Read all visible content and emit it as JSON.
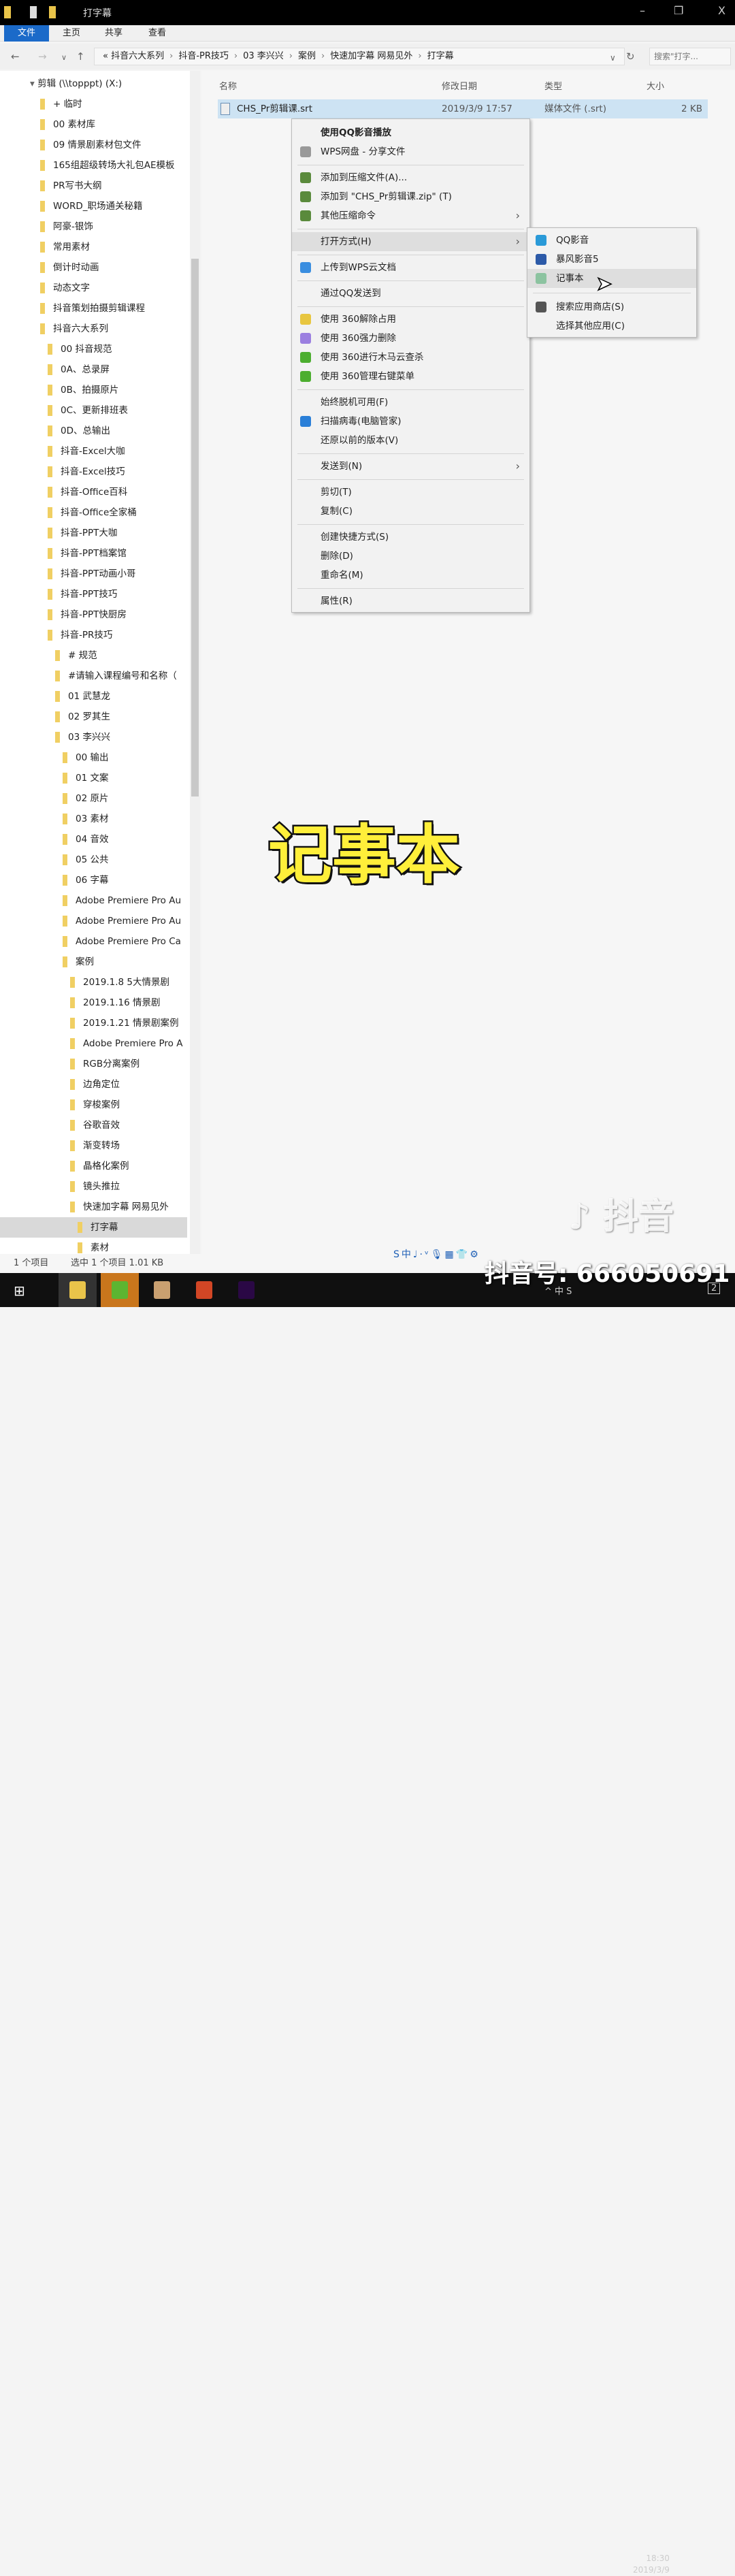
{
  "window": {
    "title": "打字幕",
    "min": "–",
    "max": "❐",
    "close": "X"
  },
  "ribbon": {
    "tabs": [
      "文件",
      "主页",
      "共享",
      "查看"
    ],
    "help": "?"
  },
  "address": {
    "crumbs": [
      "«",
      "抖音六大系列",
      "抖音-PR技巧",
      "03 李兴兴",
      "案例",
      "快速加字幕 网易见外",
      "打字幕"
    ],
    "search_placeholder": "搜索\"打字...",
    "search_icon": "magnifier-icon"
  },
  "columns": {
    "name": "名称",
    "date": "修改日期",
    "type": "类型",
    "size": "大小"
  },
  "file": {
    "name": "CHS_Pr剪辑课.srt",
    "date": "2019/3/9 17:57",
    "type": "媒体文件 (.srt)",
    "size": "2 KB"
  },
  "sidebar": [
    {
      "label": "剪辑 (\\\\topppt) (X:)",
      "level": -1,
      "drive": true
    },
    {
      "label": "+ 临时",
      "level": 0
    },
    {
      "label": "00 素材库",
      "level": 0
    },
    {
      "label": "09 情景剧素材包文件",
      "level": 0
    },
    {
      "label": "165组超级转场大礼包AE模板",
      "level": 0
    },
    {
      "label": "PR写书大纲",
      "level": 0
    },
    {
      "label": "WORD_职场通关秘籍",
      "level": 0
    },
    {
      "label": "阿豪-银饰",
      "level": 0
    },
    {
      "label": "常用素材",
      "level": 0
    },
    {
      "label": "倒计时动画",
      "level": 0
    },
    {
      "label": "动态文字",
      "level": 0
    },
    {
      "label": "抖音策划拍摄剪辑课程",
      "level": 0
    },
    {
      "label": "抖音六大系列",
      "level": 0
    },
    {
      "label": "00 抖音规范",
      "level": 1
    },
    {
      "label": "0A、总录屏",
      "level": 1
    },
    {
      "label": "0B、拍摄原片",
      "level": 1
    },
    {
      "label": "0C、更新排班表",
      "level": 1
    },
    {
      "label": "0D、总输出",
      "level": 1
    },
    {
      "label": "抖音-Excel大咖",
      "level": 1
    },
    {
      "label": "抖音-Excel技巧",
      "level": 1
    },
    {
      "label": "抖音-Office百科",
      "level": 1
    },
    {
      "label": "抖音-Office全家桶",
      "level": 1
    },
    {
      "label": "抖音-PPT大咖",
      "level": 1
    },
    {
      "label": "抖音-PPT档案馆",
      "level": 1
    },
    {
      "label": "抖音-PPT动画小哥",
      "level": 1
    },
    {
      "label": "抖音-PPT技巧",
      "level": 1
    },
    {
      "label": "抖音-PPT快厨房",
      "level": 1
    },
    {
      "label": "抖音-PR技巧",
      "level": 1
    },
    {
      "label": "# 规范",
      "level": 2
    },
    {
      "label": "#请输入课程编号和名称（",
      "level": 2
    },
    {
      "label": "01 武慧龙",
      "level": 2
    },
    {
      "label": "02 罗其生",
      "level": 2
    },
    {
      "label": "03 李兴兴",
      "level": 2
    },
    {
      "label": "00 输出",
      "level": 3
    },
    {
      "label": "01 文案",
      "level": 3
    },
    {
      "label": "02 原片",
      "level": 3
    },
    {
      "label": "03 素材",
      "level": 3
    },
    {
      "label": "04 音效",
      "level": 3
    },
    {
      "label": "05 公共",
      "level": 3
    },
    {
      "label": "06 字幕",
      "level": 3
    },
    {
      "label": "Adobe Premiere Pro Au",
      "level": 3
    },
    {
      "label": "Adobe Premiere Pro Au",
      "level": 3
    },
    {
      "label": "Adobe Premiere Pro Ca",
      "level": 3
    },
    {
      "label": "案例",
      "level": 3
    },
    {
      "label": "2019.1.8 5大情景剧",
      "level": 4
    },
    {
      "label": "2019.1.16 情景剧",
      "level": 4
    },
    {
      "label": "2019.1.21 情景剧案例",
      "level": 4
    },
    {
      "label": "Adobe Premiere Pro A",
      "level": 4
    },
    {
      "label": "RGB分离案例",
      "level": 4
    },
    {
      "label": "边角定位",
      "level": 4
    },
    {
      "label": "穿梭案例",
      "level": 4
    },
    {
      "label": "谷歌音效",
      "level": 4
    },
    {
      "label": "渐变转场",
      "level": 4
    },
    {
      "label": "晶格化案例",
      "level": 4
    },
    {
      "label": "镜头推拉",
      "level": 4
    },
    {
      "label": "快速加字幕 网易见外",
      "level": 4
    },
    {
      "label": "打字幕",
      "level": 5,
      "selected": true
    },
    {
      "label": "素材",
      "level": 5
    }
  ],
  "context_menu": [
    {
      "label": "使用QQ影音播放",
      "bold": true
    },
    {
      "label": "WPS网盘 - 分享文件",
      "icon": "share-icon"
    },
    {
      "sep": true
    },
    {
      "label": "添加到压缩文件(A)...",
      "icon": "winrar-icon",
      "color": "#5a8a3c"
    },
    {
      "label": "添加到 \"CHS_Pr剪辑课.zip\" (T)",
      "icon": "winrar-icon",
      "color": "#5a8a3c"
    },
    {
      "label": "其他压缩命令",
      "icon": "winrar-icon",
      "color": "#5a8a3c",
      "submenu": true
    },
    {
      "sep": true
    },
    {
      "label": "打开方式(H)",
      "submenu": true,
      "highlight": true
    },
    {
      "sep": true
    },
    {
      "label": "上传到WPS云文档",
      "icon": "wps-cloud-icon",
      "color": "#3a8ee0"
    },
    {
      "sep": true
    },
    {
      "label": "通过QQ发送到"
    },
    {
      "sep": true
    },
    {
      "label": "使用 360解除占用",
      "icon": "360-unlock-icon",
      "color": "#e8c640"
    },
    {
      "label": "使用 360强力删除",
      "icon": "360-delete-icon",
      "color": "#9b7fe0"
    },
    {
      "label": "使用 360进行木马云查杀",
      "icon": "360-scan-icon",
      "color": "#4cae2f"
    },
    {
      "label": "使用 360管理右键菜单",
      "icon": "360-menu-icon",
      "color": "#4cae2f"
    },
    {
      "sep": true
    },
    {
      "label": "始终脱机可用(F)"
    },
    {
      "label": "扫描病毒(电脑管家)",
      "icon": "pc-manager-icon",
      "color": "#2a7fd8"
    },
    {
      "label": "还原以前的版本(V)"
    },
    {
      "sep": true
    },
    {
      "label": "发送到(N)",
      "submenu": true
    },
    {
      "sep": true
    },
    {
      "label": "剪切(T)"
    },
    {
      "label": "复制(C)"
    },
    {
      "sep": true
    },
    {
      "label": "创建快捷方式(S)"
    },
    {
      "label": "删除(D)"
    },
    {
      "label": "重命名(M)"
    },
    {
      "sep": true
    },
    {
      "label": "属性(R)"
    }
  ],
  "open_with_menu": [
    {
      "label": "QQ影音",
      "icon": "qq-player-icon",
      "color": "#2a9ad8"
    },
    {
      "label": "暴风影音5",
      "icon": "baofeng-icon",
      "color": "#2c5aa8"
    },
    {
      "label": "记事本",
      "icon": "notepad-icon",
      "color": "#8cc3a0",
      "highlight": true
    },
    {
      "sep": true
    },
    {
      "label": "搜索应用商店(S)",
      "icon": "store-icon",
      "color": "#555"
    },
    {
      "label": "选择其他应用(C)"
    }
  ],
  "caption": "记事本",
  "status": {
    "count": "1 个项目",
    "selected": "选中 1 个项目  1.01 KB"
  },
  "ime_bar": "S中♩·ᵛ🎙▦👕⚙",
  "watermark": {
    "logo": "♪ 抖音",
    "account": "抖音号: 666050691"
  },
  "taskbar": {
    "apps": [
      {
        "name": "file-explorer-icon",
        "color": "#e9c44a"
      },
      {
        "name": "browser-icon",
        "color": "#5cb531"
      },
      {
        "name": "photo-app-icon",
        "color": "#c9a070"
      },
      {
        "name": "powerpoint-icon",
        "color": "#d24625"
      },
      {
        "name": "premiere-icon",
        "color": "#2a0845"
      }
    ],
    "tray": "^ 中 S",
    "time": "18:30",
    "date": "2019/3/9",
    "notif": "2"
  }
}
